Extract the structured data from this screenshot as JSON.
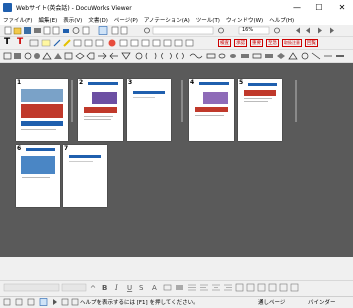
{
  "window": {
    "title": "Webサイト(英会話) - DocuWorks Viewer",
    "minimize": "—",
    "maximize": "☐",
    "close": "✕"
  },
  "menu": [
    "ファイル(F)",
    "編集(E)",
    "表示(V)",
    "文書(D)",
    "ページ(P)",
    "アノテーション(A)",
    "ツール(T)",
    "ウィンドウ(W)",
    "ヘルプ(H)"
  ],
  "toolbar": {
    "zoom_value": "16%",
    "stamps": [
      "検査",
      "承認",
      "重要",
      "至急",
      "取扱注意",
      "回覧"
    ]
  },
  "pages": [
    "1",
    "2",
    "3",
    "4",
    "5",
    "6",
    "7"
  ],
  "status": {
    "help_text": "ヘルプを表示するには [F1] を押してください。",
    "page_mode": "通しページ",
    "binder": "バインダー"
  },
  "colors": {
    "accent": "#1f5fae",
    "workspace": "#5a5a5a"
  }
}
